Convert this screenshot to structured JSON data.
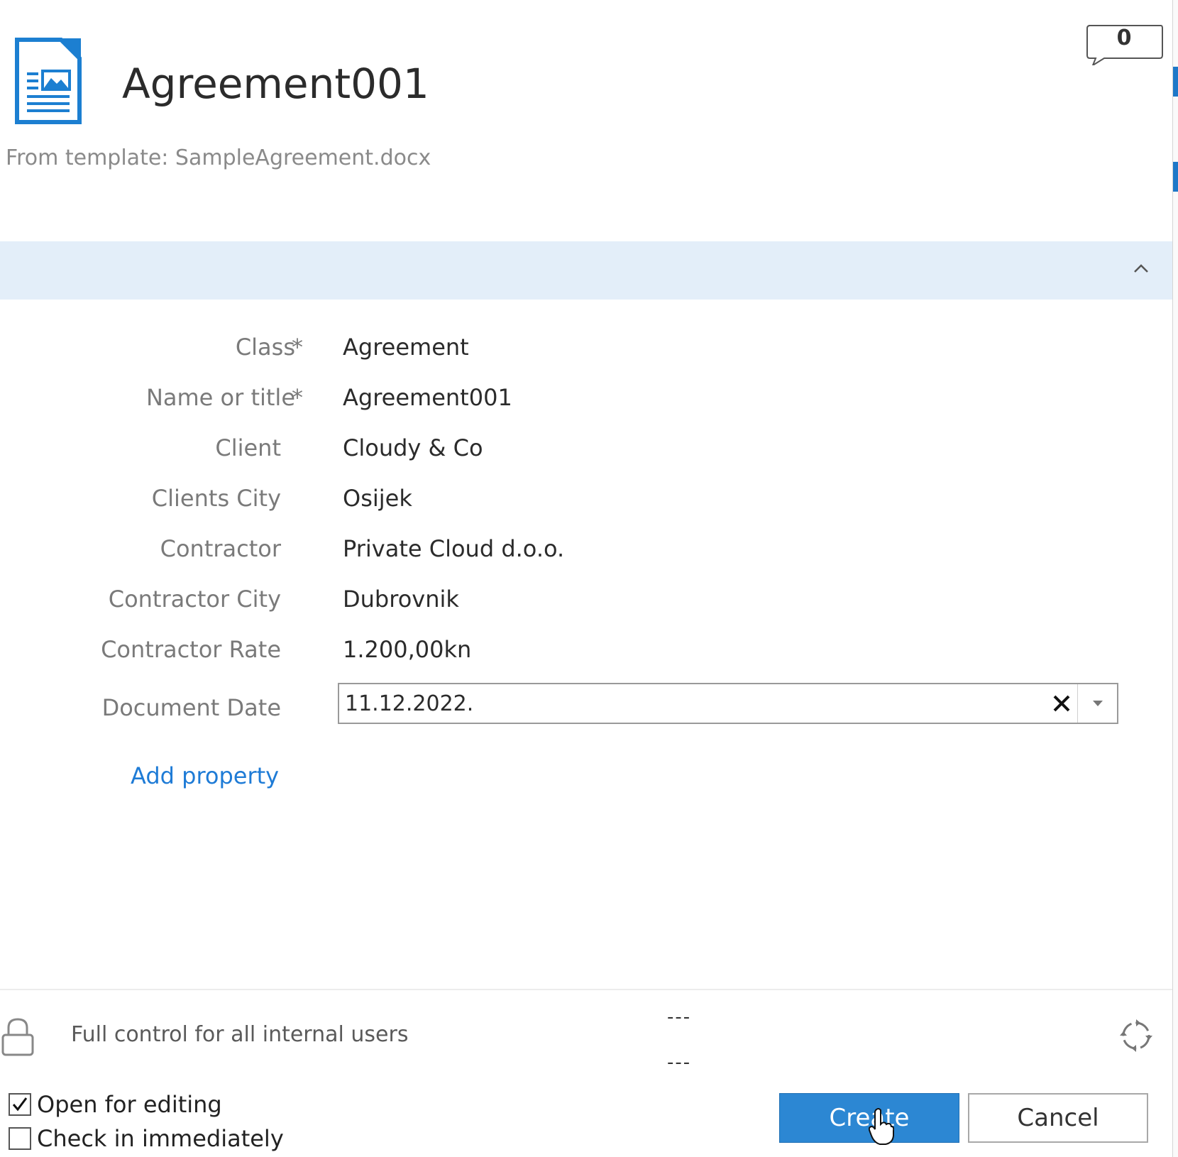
{
  "header": {
    "title": "Agreement001",
    "template_info": "From template: SampleAgreement.docx",
    "comment_count": "0",
    "icon": "document-icon"
  },
  "properties": [
    {
      "label": "Class",
      "required": true,
      "value": "Agreement"
    },
    {
      "label": "Name or title",
      "required": true,
      "value": "Agreement001"
    },
    {
      "label": "Client",
      "required": false,
      "value": "Cloudy & Co"
    },
    {
      "label": "Clients City",
      "required": false,
      "value": "Osijek"
    },
    {
      "label": "Contractor",
      "required": false,
      "value": "Private Cloud d.o.o."
    },
    {
      "label": "Contractor City",
      "required": false,
      "value": "Dubrovnik"
    },
    {
      "label": "Contractor Rate",
      "required": false,
      "value": "1.200,00kn"
    }
  ],
  "required_marker": "*",
  "document_date": {
    "label": "Document Date",
    "value": "11.12.2022."
  },
  "add_property_label": "Add property",
  "permissions": {
    "text": "Full control for all internal users",
    "dash_top": "---",
    "dash_bottom": "---"
  },
  "options": {
    "open_for_editing": {
      "label": "Open for editing",
      "checked": true
    },
    "check_in_immediately": {
      "label": "Check in immediately",
      "checked": false
    }
  },
  "buttons": {
    "create": "Create",
    "cancel": "Cancel"
  },
  "colors": {
    "accent": "#2c87d3",
    "section_bar": "#e3eef9",
    "link": "#1e7bd6"
  }
}
